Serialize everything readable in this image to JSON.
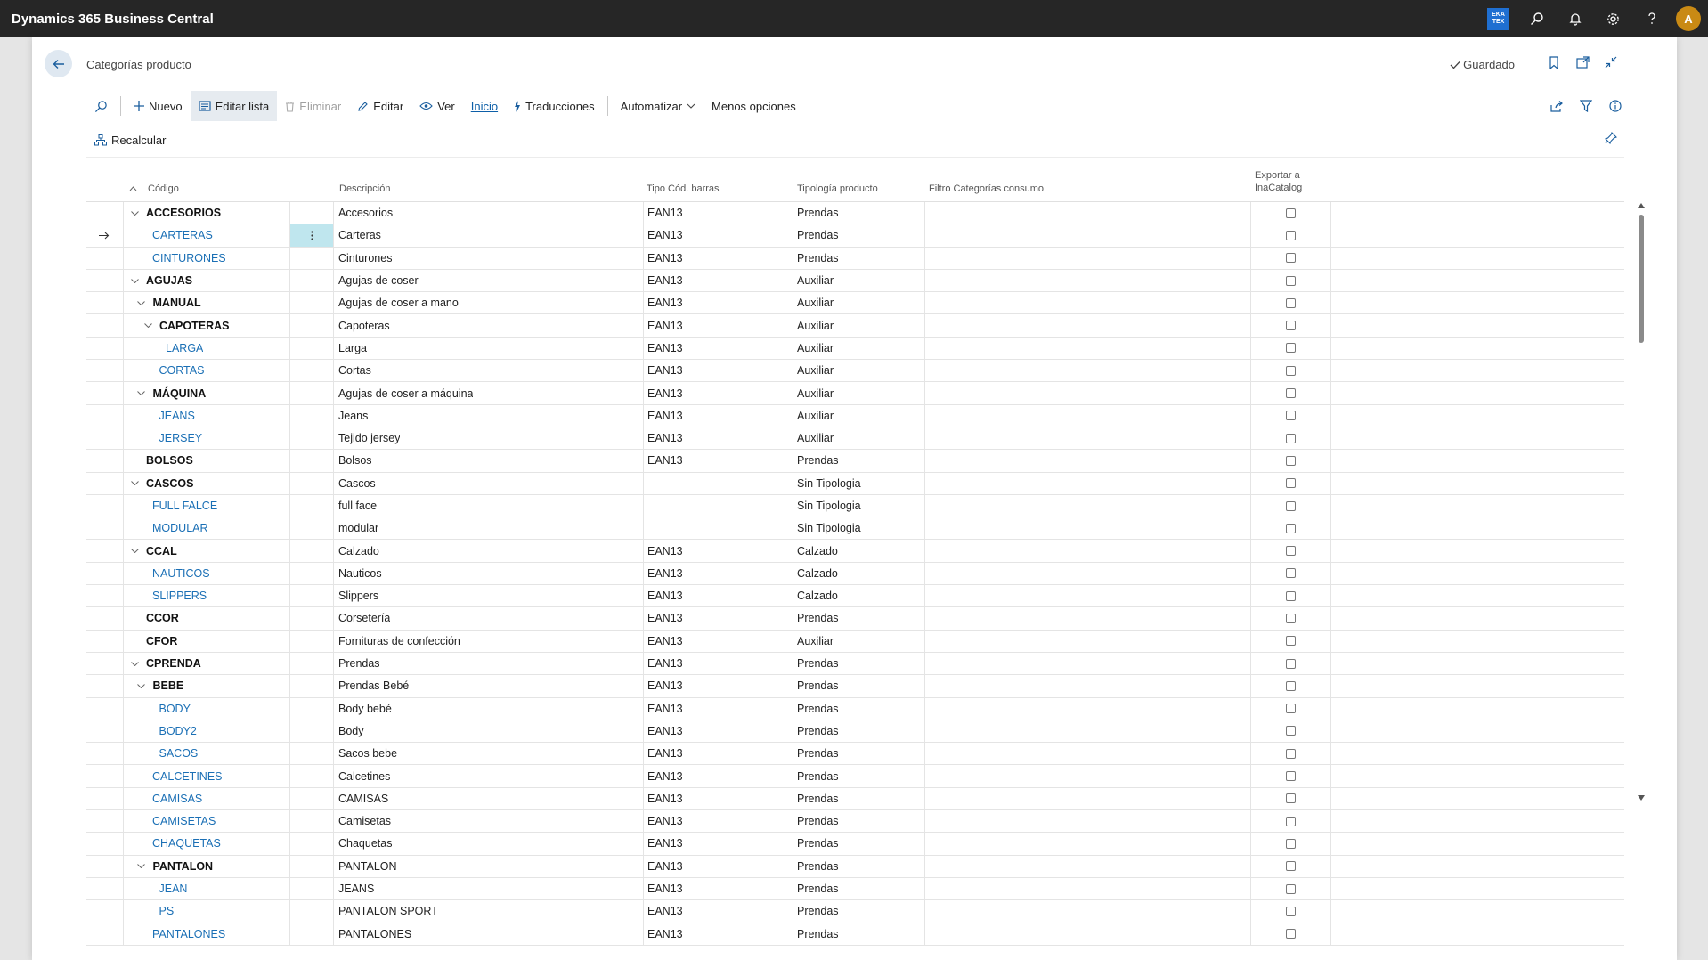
{
  "app": {
    "title": "Dynamics 365 Business Central",
    "company_badge": "EKA TEX",
    "avatar_initial": "A"
  },
  "page": {
    "title": "Categorías producto",
    "saved_label": "Guardado"
  },
  "actions": {
    "nuevo": "Nuevo",
    "editar_lista": "Editar lista",
    "eliminar": "Eliminar",
    "editar": "Editar",
    "ver": "Ver",
    "inicio": "Inicio",
    "traducciones": "Traducciones",
    "automatizar": "Automatizar",
    "menos_opciones": "Menos opciones",
    "recalcular": "Recalcular"
  },
  "columns": {
    "codigo": "Código",
    "descripcion": "Descripción",
    "tipo_cod_barras": "Tipo Cód. barras",
    "tipologia": "Tipología producto",
    "filtro": "Filtro Categorías consumo",
    "exportar_1": "Exportar a",
    "exportar_2": "InaCatalog"
  },
  "rows": [
    {
      "code": "ACCESORIOS",
      "level": 0,
      "group": true,
      "expanded": true,
      "desc": "Accesorios",
      "barcode": "EAN13",
      "tipo": "Prendas"
    },
    {
      "code": "CARTERAS",
      "level": 1,
      "group": false,
      "desc": "Carteras",
      "barcode": "EAN13",
      "tipo": "Prendas",
      "selected": true
    },
    {
      "code": "CINTURONES",
      "level": 1,
      "group": false,
      "desc": "Cinturones",
      "barcode": "EAN13",
      "tipo": "Prendas"
    },
    {
      "code": "AGUJAS",
      "level": 0,
      "group": true,
      "expanded": true,
      "desc": "Agujas de coser",
      "barcode": "EAN13",
      "tipo": "Auxiliar"
    },
    {
      "code": "MANUAL",
      "level": 1,
      "group": true,
      "expanded": true,
      "desc": "Agujas de coser a mano",
      "barcode": "EAN13",
      "tipo": "Auxiliar"
    },
    {
      "code": "CAPOTERAS",
      "level": 2,
      "group": true,
      "expanded": true,
      "desc": "Capoteras",
      "barcode": "EAN13",
      "tipo": "Auxiliar"
    },
    {
      "code": "LARGA",
      "level": 3,
      "group": false,
      "desc": "Larga",
      "barcode": "EAN13",
      "tipo": "Auxiliar"
    },
    {
      "code": "CORTAS",
      "level": 2,
      "group": false,
      "desc": "Cortas",
      "barcode": "EAN13",
      "tipo": "Auxiliar"
    },
    {
      "code": "MÁQUINA",
      "level": 1,
      "group": true,
      "expanded": true,
      "desc": "Agujas de coser a máquina",
      "barcode": "EAN13",
      "tipo": "Auxiliar"
    },
    {
      "code": "JEANS",
      "level": 2,
      "group": false,
      "desc": "Jeans",
      "barcode": "EAN13",
      "tipo": "Auxiliar"
    },
    {
      "code": "JERSEY",
      "level": 2,
      "group": false,
      "desc": "Tejido jersey",
      "barcode": "EAN13",
      "tipo": "Auxiliar"
    },
    {
      "code": "BOLSOS",
      "level": 0,
      "group": true,
      "expanded": false,
      "desc": "Bolsos",
      "barcode": "EAN13",
      "tipo": "Prendas"
    },
    {
      "code": "CASCOS",
      "level": 0,
      "group": true,
      "expanded": true,
      "desc": "Cascos",
      "barcode": "",
      "tipo": "Sin Tipologia"
    },
    {
      "code": "FULL FALCE",
      "level": 1,
      "group": false,
      "desc": "full face",
      "barcode": "",
      "tipo": "Sin Tipologia"
    },
    {
      "code": "MODULAR",
      "level": 1,
      "group": false,
      "desc": "modular",
      "barcode": "",
      "tipo": "Sin Tipologia"
    },
    {
      "code": "CCAL",
      "level": 0,
      "group": true,
      "expanded": true,
      "desc": "Calzado",
      "barcode": "EAN13",
      "tipo": "Calzado"
    },
    {
      "code": "NAUTICOS",
      "level": 1,
      "group": false,
      "desc": "Nauticos",
      "barcode": "EAN13",
      "tipo": "Calzado"
    },
    {
      "code": "SLIPPERS",
      "level": 1,
      "group": false,
      "desc": "Slippers",
      "barcode": "EAN13",
      "tipo": "Calzado"
    },
    {
      "code": "CCOR",
      "level": 0,
      "group": true,
      "expanded": false,
      "desc": "Corsetería",
      "barcode": "EAN13",
      "tipo": "Prendas"
    },
    {
      "code": "CFOR",
      "level": 0,
      "group": true,
      "expanded": false,
      "desc": "Fornituras de confección",
      "barcode": "EAN13",
      "tipo": "Auxiliar"
    },
    {
      "code": "CPRENDA",
      "level": 0,
      "group": true,
      "expanded": true,
      "desc": "Prendas",
      "barcode": "EAN13",
      "tipo": "Prendas"
    },
    {
      "code": "BEBE",
      "level": 1,
      "group": true,
      "expanded": true,
      "desc": "Prendas Bebé",
      "barcode": "EAN13",
      "tipo": "Prendas"
    },
    {
      "code": "BODY",
      "level": 2,
      "group": false,
      "desc": "Body bebé",
      "barcode": "EAN13",
      "tipo": "Prendas"
    },
    {
      "code": "BODY2",
      "level": 2,
      "group": false,
      "desc": "Body",
      "barcode": "EAN13",
      "tipo": "Prendas"
    },
    {
      "code": "SACOS",
      "level": 2,
      "group": false,
      "desc": "Sacos bebe",
      "barcode": "EAN13",
      "tipo": "Prendas"
    },
    {
      "code": "CALCETINES",
      "level": 1,
      "group": false,
      "desc": "Calcetines",
      "barcode": "EAN13",
      "tipo": "Prendas"
    },
    {
      "code": "CAMISAS",
      "level": 1,
      "group": false,
      "desc": "CAMISAS",
      "barcode": "EAN13",
      "tipo": "Prendas"
    },
    {
      "code": "CAMISETAS",
      "level": 1,
      "group": false,
      "desc": "Camisetas",
      "barcode": "EAN13",
      "tipo": "Prendas"
    },
    {
      "code": "CHAQUETAS",
      "level": 1,
      "group": false,
      "desc": "Chaquetas",
      "barcode": "EAN13",
      "tipo": "Prendas"
    },
    {
      "code": "PANTALON",
      "level": 1,
      "group": true,
      "expanded": true,
      "desc": "PANTALON",
      "barcode": "EAN13",
      "tipo": "Prendas"
    },
    {
      "code": "JEAN",
      "level": 2,
      "group": false,
      "desc": "JEANS",
      "barcode": "EAN13",
      "tipo": "Prendas"
    },
    {
      "code": "PS",
      "level": 2,
      "group": false,
      "desc": "PANTALON SPORT",
      "barcode": "EAN13",
      "tipo": "Prendas"
    },
    {
      "code": "PANTALONES",
      "level": 1,
      "group": false,
      "desc": "PANTALONES",
      "barcode": "EAN13",
      "tipo": "Prendas"
    }
  ]
}
